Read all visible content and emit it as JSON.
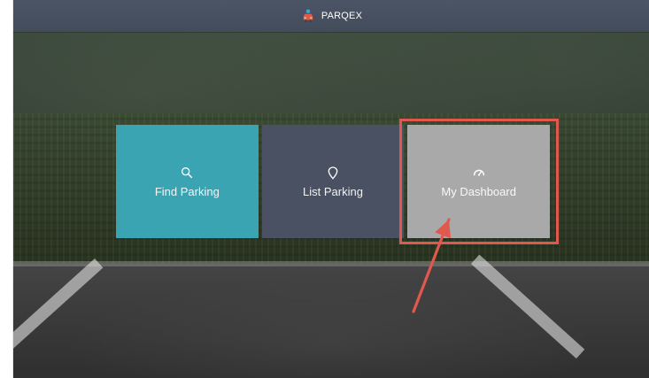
{
  "app": {
    "brand_name": "PARQEX"
  },
  "tiles": [
    {
      "label": "Find Parking",
      "icon": "search-icon",
      "color": "#3aa4b3"
    },
    {
      "label": "List Parking",
      "icon": "map-pin-icon",
      "color": "#4a5162"
    },
    {
      "label": "My Dashboard",
      "icon": "speedometer-icon",
      "color": "#a9a9a9"
    }
  ],
  "annotation": {
    "highlight_color": "#e1584f"
  }
}
